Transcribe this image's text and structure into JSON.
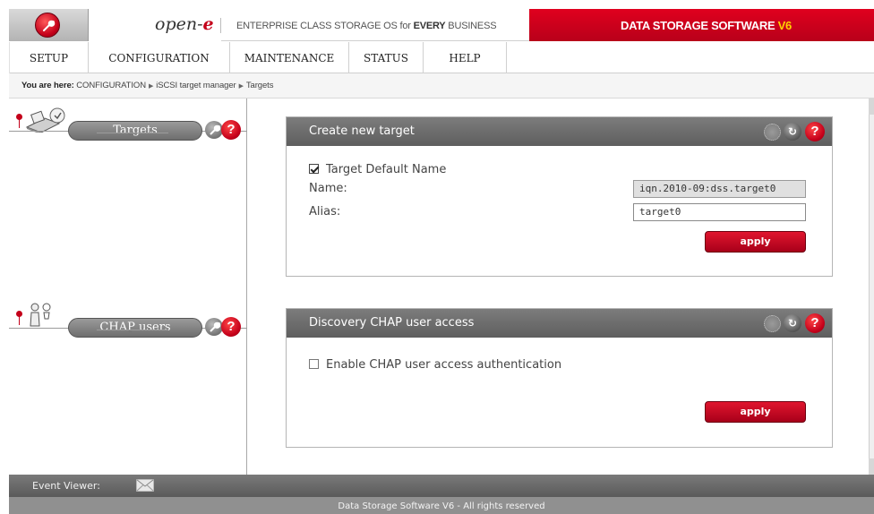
{
  "header": {
    "brand_prefix": "open-",
    "brand_suffix": "e",
    "slogan_pre": "ENTERPRISE CLASS STORAGE OS for ",
    "slogan_bold": "EVERY",
    "slogan_post": " BUSINESS",
    "product_name": "DATA STORAGE SOFTWARE ",
    "product_version": "V6"
  },
  "menu": {
    "items": [
      {
        "label": "SETUP"
      },
      {
        "label": "CONFIGURATION"
      },
      {
        "label": "MAINTENANCE"
      },
      {
        "label": "STATUS"
      },
      {
        "label": "HELP"
      }
    ]
  },
  "breadcrumb": {
    "prefix": "You are here:",
    "items": [
      "CONFIGURATION",
      "iSCSI target manager",
      "Targets"
    ]
  },
  "sidebar": {
    "targets_label": "Targets",
    "chap_label": "CHAP users"
  },
  "create_target": {
    "title": "Create new target",
    "default_name_checked": true,
    "default_name_label": "Target Default Name",
    "name_label": "Name:",
    "name_value": "iqn.2010-09:dss.target0",
    "alias_label": "Alias:",
    "alias_value": "target0",
    "apply_label": "apply"
  },
  "discovery_chap": {
    "title": "Discovery CHAP user access",
    "enable_checked": false,
    "enable_label": "Enable CHAP user access authentication",
    "apply_label": "apply"
  },
  "event_bar": {
    "label": "Event Viewer:"
  },
  "footer": {
    "text": "Data Storage Software V6 - All rights reserved"
  },
  "colors": {
    "brand_red": "#c4001a",
    "panel_header": "#6e6e6e",
    "accent_yellow": "#ffd200"
  }
}
